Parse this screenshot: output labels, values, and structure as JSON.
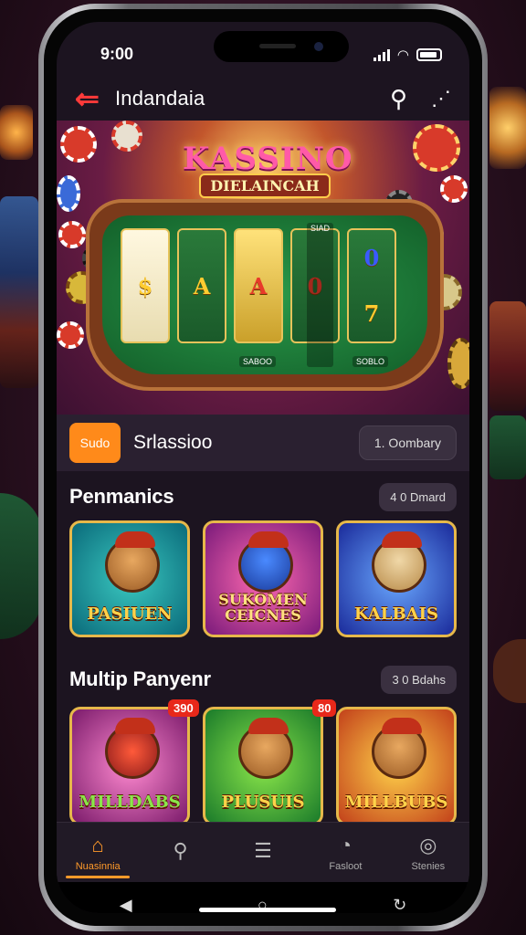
{
  "status": {
    "time": "9:00"
  },
  "header": {
    "title": "Indandaia"
  },
  "hero": {
    "logo_main": "KASSINO",
    "logo_sub": "DIELAINCAH",
    "reel_symbols": [
      [
        "$"
      ],
      [
        "A"
      ],
      [
        "A"
      ],
      [
        "0"
      ],
      [
        "0"
      ],
      [
        "7"
      ]
    ],
    "felt_labels": [
      "SIAD",
      "SABOO",
      "SOBLO"
    ]
  },
  "info": {
    "badge": "Sudo",
    "title": "Srlassioo",
    "pill": "1. Oombary"
  },
  "section1": {
    "title": "Penmanics",
    "pill": "4 0 Dmard",
    "cards": [
      {
        "label": "PASIUEN"
      },
      {
        "label": "SUKOMEN CEICNES"
      },
      {
        "label": "KALBAIS"
      }
    ]
  },
  "section2": {
    "title": "Multip Panyenr",
    "pill": "3 0 Bdahs",
    "cards": [
      {
        "label": "MILLDABS",
        "tag": "390"
      },
      {
        "label": "PLUSUIS",
        "tag": "80"
      },
      {
        "label": "MILLBUBS"
      }
    ]
  },
  "bottom_nav": [
    {
      "label": "Nuasinnia",
      "icon": "home-icon",
      "active": true
    },
    {
      "label": "",
      "icon": "search-icon",
      "active": false
    },
    {
      "label": "",
      "icon": "list-icon",
      "active": false
    },
    {
      "label": "Fasloot",
      "icon": "profile-icon",
      "active": false
    },
    {
      "label": "Stenies",
      "icon": "chat-icon",
      "active": false
    }
  ],
  "colors": {
    "accent": "#ff9a2a",
    "back_arrow": "#ff3a3a",
    "tag": "#e8281a"
  }
}
